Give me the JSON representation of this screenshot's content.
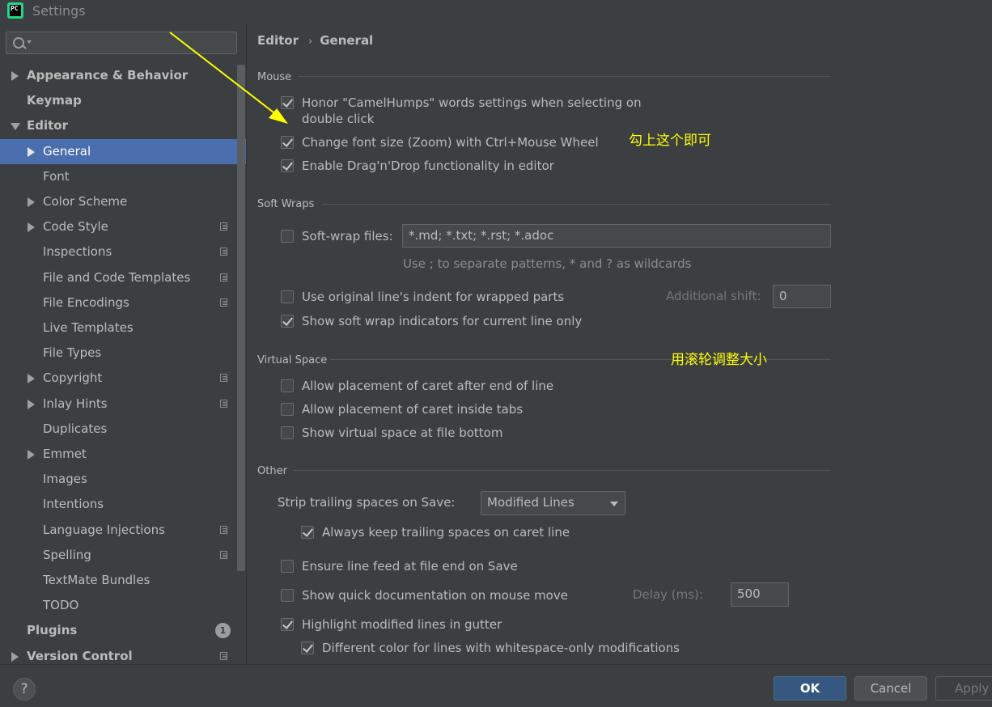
{
  "window": {
    "title": "Settings",
    "app_icon": "pycharm-icon",
    "app_icon_text": "PC"
  },
  "sidebar": {
    "search": {
      "placeholder": "",
      "value": ""
    },
    "items": [
      {
        "label": "Appearance & Behavior",
        "expandable": true,
        "bold": true
      },
      {
        "label": "Keymap",
        "bold": true
      },
      {
        "label": "Editor",
        "expanded": true,
        "bold": true
      },
      {
        "label": "General",
        "expandable": true,
        "selected": true
      },
      {
        "label": "Font"
      },
      {
        "label": "Color Scheme",
        "expandable": true
      },
      {
        "label": "Code Style",
        "expandable": true,
        "project_icon": true
      },
      {
        "label": "Inspections",
        "project_icon": true
      },
      {
        "label": "File and Code Templates",
        "project_icon": true
      },
      {
        "label": "File Encodings",
        "project_icon": true
      },
      {
        "label": "Live Templates"
      },
      {
        "label": "File Types"
      },
      {
        "label": "Copyright",
        "expandable": true,
        "project_icon": true
      },
      {
        "label": "Inlay Hints",
        "expandable": true,
        "project_icon": true
      },
      {
        "label": "Duplicates"
      },
      {
        "label": "Emmet",
        "expandable": true
      },
      {
        "label": "Images"
      },
      {
        "label": "Intentions"
      },
      {
        "label": "Language Injections",
        "project_icon": true
      },
      {
        "label": "Spelling",
        "project_icon": true
      },
      {
        "label": "TextMate Bundles"
      },
      {
        "label": "TODO"
      },
      {
        "label": "Plugins",
        "bold": true,
        "badge": "1"
      },
      {
        "label": "Version Control",
        "expandable": true,
        "bold": true,
        "project_icon": true
      }
    ]
  },
  "breadcrumb": {
    "parent": "Editor",
    "current": "General"
  },
  "sections": {
    "mouse": {
      "title": "Mouse",
      "options": [
        {
          "label": "Honor \"CamelHumps\" words settings when selecting on",
          "label2": "double click",
          "checked": true
        },
        {
          "label": "Change font size (Zoom) with Ctrl+Mouse Wheel",
          "checked": true
        },
        {
          "label": "Enable Drag'n'Drop functionality in editor",
          "checked": true
        }
      ]
    },
    "soft_wraps": {
      "title": "Soft Wraps",
      "soft_wrap_files": {
        "label": "Soft-wrap files:",
        "checked": false,
        "value": "*.md; *.txt; *.rst; *.adoc"
      },
      "hint": "Use ; to separate patterns, * and ? as wildcards",
      "original_indent": {
        "label": "Use original line's indent for wrapped parts",
        "checked": false
      },
      "additional_shift": {
        "label": "Additional shift:",
        "value": "0"
      },
      "indicators": {
        "label": "Show soft wrap indicators for current line only",
        "checked": true
      }
    },
    "virtual_space": {
      "title": "Virtual Space",
      "options": [
        {
          "label": "Allow placement of caret after end of line",
          "checked": false
        },
        {
          "label": "Allow placement of caret inside tabs",
          "checked": false
        },
        {
          "label": "Show virtual space at file bottom",
          "checked": false
        }
      ]
    },
    "other": {
      "title": "Other",
      "strip_label": "Strip trailing spaces on Save:",
      "strip_value": "Modified Lines",
      "keep_trailing": {
        "label": "Always keep trailing spaces on caret line",
        "checked": true
      },
      "line_feed": {
        "label": "Ensure line feed at file end on Save",
        "checked": false
      },
      "quick_doc": {
        "label": "Show quick documentation on mouse move",
        "checked": false
      },
      "delay": {
        "label": "Delay (ms):",
        "value": "500"
      },
      "highlight_modified": {
        "label": "Highlight modified lines in gutter",
        "checked": true
      },
      "diff_color": {
        "label": "Different color for lines with whitespace-only modifications",
        "checked": true
      }
    }
  },
  "annotations": {
    "check_this": "勾上这个即可",
    "wheel_resize": "用滚轮调整大小",
    "color": "#ffff00"
  },
  "footer": {
    "help": "?",
    "ok": "OK",
    "cancel": "Cancel",
    "apply": "Apply"
  }
}
